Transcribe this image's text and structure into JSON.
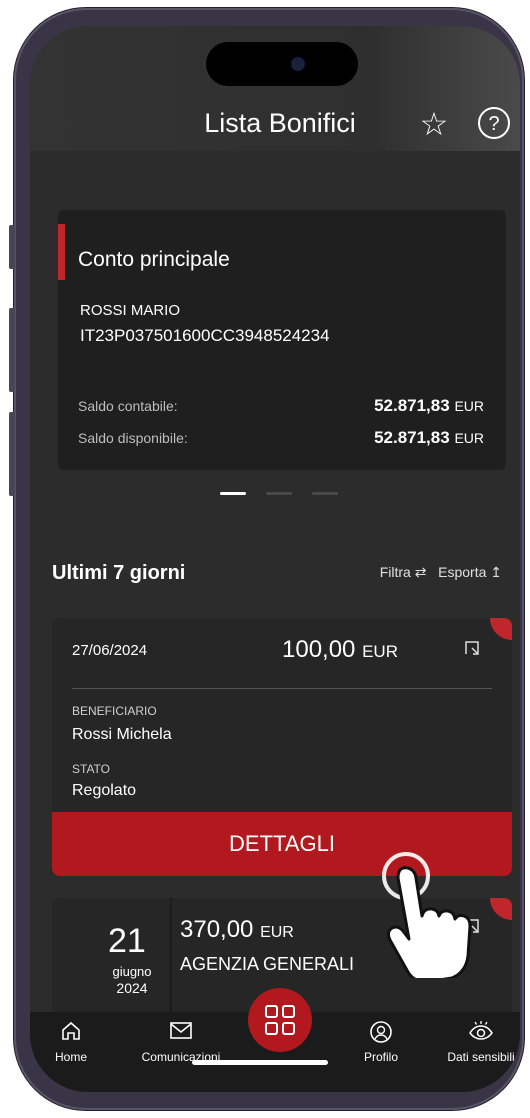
{
  "header": {
    "title": "Lista Bonifici",
    "favorite_icon": "star-icon",
    "help_icon": "help-icon"
  },
  "account": {
    "name": "Conto principale",
    "holder": "ROSSI MARIO",
    "iban": "IT23P037501600CC3948524234",
    "balances": [
      {
        "label": "Saldo contabile:",
        "amount": "52.871,83",
        "currency": "EUR"
      },
      {
        "label": "Saldo disponibile:",
        "amount": "52.871,83",
        "currency": "EUR"
      }
    ],
    "pager": {
      "total": 3,
      "active": 1
    }
  },
  "section": {
    "title": "Ultimi 7 giorni",
    "filter_label": "Filtra",
    "filter_icon": "sliders-icon",
    "export_label": "Esporta",
    "export_icon": "upload-icon"
  },
  "transfers": [
    {
      "date": "27/06/2024",
      "amount": "100,00",
      "currency": "EUR",
      "beneficiary_label": "BENEFICIARIO",
      "beneficiary": "Rossi Michela",
      "status_label": "STATO",
      "status": "Regolato",
      "details_label": "DETTAGLI"
    },
    {
      "day": "21",
      "month": "giugno",
      "year": "2024",
      "amount": "370,00",
      "currency": "EUR",
      "beneficiary": "AGENZIA GENERALI"
    }
  ],
  "nav": [
    {
      "label": "Home",
      "icon": "home-icon"
    },
    {
      "label": "Comunicazioni",
      "icon": "mail-icon"
    },
    {
      "label": "",
      "icon": "grid-icon"
    },
    {
      "label": "Profilo",
      "icon": "profile-icon"
    },
    {
      "label": "Dati sensibili",
      "icon": "eye-icon"
    }
  ],
  "colors": {
    "accent": "#b1191e",
    "background": "#2c2c2c",
    "card": "#262626"
  }
}
